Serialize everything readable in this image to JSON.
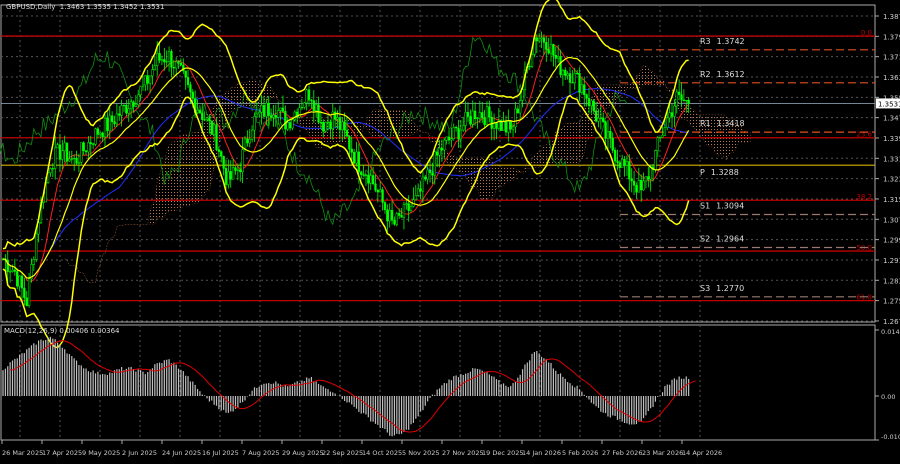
{
  "header": {
    "symbol_timeframe": "GBPUSD,Daily",
    "ohlc": "1.3463 1.3535 1.3452 1.3531"
  },
  "macd": {
    "label": "MACD(12,26,9) 0.00406 0.00364",
    "axis_top": "0.01451",
    "axis_zero": "0.00",
    "axis_bottom": "-0.01046"
  },
  "colors": {
    "background": "#000000",
    "candles": "#00ff00",
    "bollinger": "#ffff00",
    "fib": "#c00000",
    "pivot": "#e05020",
    "pivot_p": "#d4b000",
    "ma_fast": "#ff2020",
    "ma_slow": "#2030ff",
    "macd_hist": "#c0c0c0",
    "macd_signal": "#e00000"
  },
  "price_axis": {
    "ticks": [
      "1.3875",
      "1.3795",
      "1.3715",
      "1.3635",
      "1.3555",
      "1.3475",
      "1.3395",
      "1.3315",
      "1.3235",
      "1.3155",
      "1.3075",
      "1.2995",
      "1.2915",
      "1.2835",
      "1.2755",
      "1.2675"
    ],
    "current_price": "1.3531"
  },
  "time_axis": {
    "labels": [
      "26 Mar 2025",
      "17 Apr 2025",
      "9 May 2025",
      "2 Jun 2025",
      "24 Jun 2025",
      "16 Jul 2025",
      "7 Aug 2025",
      "29 Aug 2025",
      "22 Sep 2025",
      "14 Oct 2025",
      "5 Nov 2025",
      "27 Nov 2025",
      "19 Dec 2025",
      "14 Jan 2026",
      "5 Feb 2026",
      "27 Feb 2026",
      "23 Mar 2026",
      "14 Apr 2026"
    ]
  },
  "fib_levels": [
    {
      "label": "0.0",
      "price": 1.3796
    },
    {
      "label": "23.6",
      "price": 1.3396
    },
    {
      "label": "38.2",
      "price": 1.315
    },
    {
      "label": "50.0",
      "price": 1.295
    },
    {
      "label": "61.8",
      "price": 1.2755
    }
  ],
  "pivots": [
    {
      "label": "R3",
      "value": "1.3742",
      "price": 1.3742
    },
    {
      "label": "R2",
      "value": "1.3612",
      "price": 1.3612
    },
    {
      "label": "R1",
      "value": "1.3418",
      "price": 1.3418
    },
    {
      "label": "P",
      "value": "1.3288",
      "price": 1.3288
    },
    {
      "label": "S1",
      "value": "1.3094",
      "price": 1.3094
    },
    {
      "label": "S2",
      "value": "1.2964",
      "price": 1.2964
    },
    {
      "label": "S3",
      "value": "1.2770",
      "price": 1.277
    }
  ],
  "chart_data": {
    "type": "candlestick",
    "price_range": [
      1.2635,
      1.3905
    ],
    "weekly_closes": [
      1.292,
      1.287,
      1.275,
      1.308,
      1.33,
      1.335,
      1.33,
      1.336,
      1.342,
      1.345,
      1.35,
      1.355,
      1.36,
      1.37,
      1.372,
      1.365,
      1.355,
      1.348,
      1.34,
      1.322,
      1.328,
      1.345,
      1.35,
      1.352,
      1.345,
      1.352,
      1.358,
      1.345,
      1.348,
      1.34,
      1.33,
      1.325,
      1.315,
      1.305,
      1.31,
      1.315,
      1.325,
      1.335,
      1.34,
      1.345,
      1.35,
      1.348,
      1.345,
      1.342,
      1.36,
      1.38,
      1.378,
      1.368,
      1.365,
      1.36,
      1.35,
      1.34,
      1.332,
      1.325,
      1.318,
      1.33,
      1.345,
      1.355,
      1.3531
    ],
    "macd_weekly": [
      0.006,
      0.008,
      0.01,
      0.012,
      0.013,
      0.011,
      0.008,
      0.006,
      0.005,
      0.005,
      0.006,
      0.006,
      0.005,
      0.007,
      0.008,
      0.006,
      0.003,
      0.0,
      -0.002,
      -0.004,
      -0.002,
      0.001,
      0.003,
      0.003,
      0.002,
      0.003,
      0.004,
      0.002,
      0.001,
      -0.001,
      -0.003,
      -0.005,
      -0.007,
      -0.009,
      -0.008,
      -0.005,
      -0.001,
      0.002,
      0.004,
      0.005,
      0.006,
      0.005,
      0.003,
      0.002,
      0.006,
      0.01,
      0.008,
      0.005,
      0.003,
      0.001,
      -0.002,
      -0.004,
      -0.005,
      -0.006,
      -0.006,
      -0.002,
      0.002,
      0.004,
      0.0041
    ]
  }
}
